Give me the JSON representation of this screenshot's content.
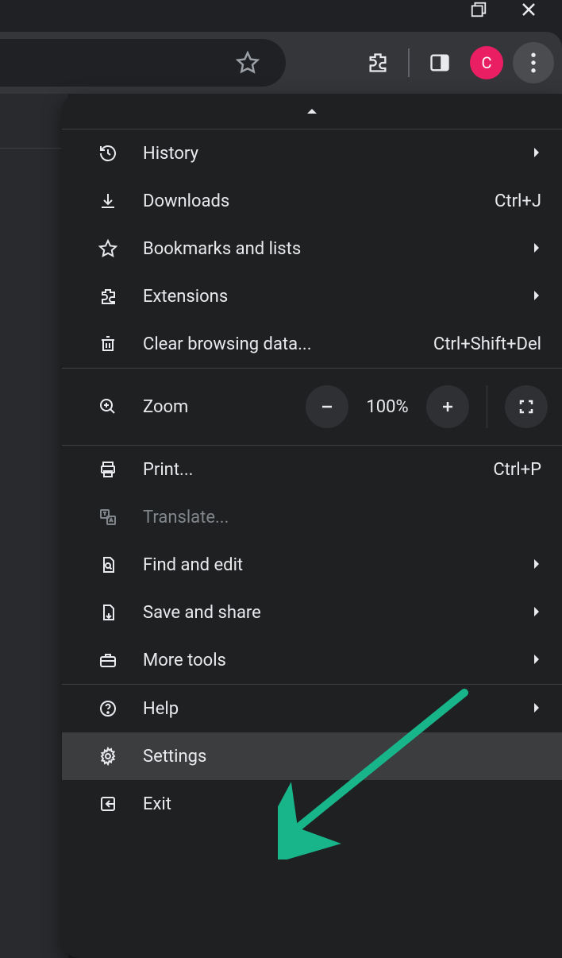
{
  "window_controls": {},
  "toolbar": {
    "avatar_letter": "C"
  },
  "menu": {
    "items": [
      {
        "icon": "history",
        "label": "History",
        "submenu": true
      },
      {
        "icon": "download",
        "label": "Downloads",
        "shortcut": "Ctrl+J"
      },
      {
        "icon": "star",
        "label": "Bookmarks and lists",
        "submenu": true
      },
      {
        "icon": "extension",
        "label": "Extensions",
        "submenu": true
      },
      {
        "icon": "trash",
        "label": "Clear browsing data...",
        "shortcut": "Ctrl+Shift+Del"
      }
    ],
    "zoom": {
      "label": "Zoom",
      "level": "100%"
    },
    "items2": [
      {
        "icon": "print",
        "label": "Print...",
        "shortcut": "Ctrl+P"
      },
      {
        "icon": "translate",
        "label": "Translate...",
        "disabled": true
      },
      {
        "icon": "findpage",
        "label": "Find and edit",
        "submenu": true
      },
      {
        "icon": "saveshare",
        "label": "Save and share",
        "submenu": true
      },
      {
        "icon": "toolbox",
        "label": "More tools",
        "submenu": true
      }
    ],
    "items3": [
      {
        "icon": "help",
        "label": "Help",
        "submenu": true
      },
      {
        "icon": "settings",
        "label": "Settings",
        "hover": true
      },
      {
        "icon": "exit",
        "label": "Exit"
      }
    ]
  }
}
